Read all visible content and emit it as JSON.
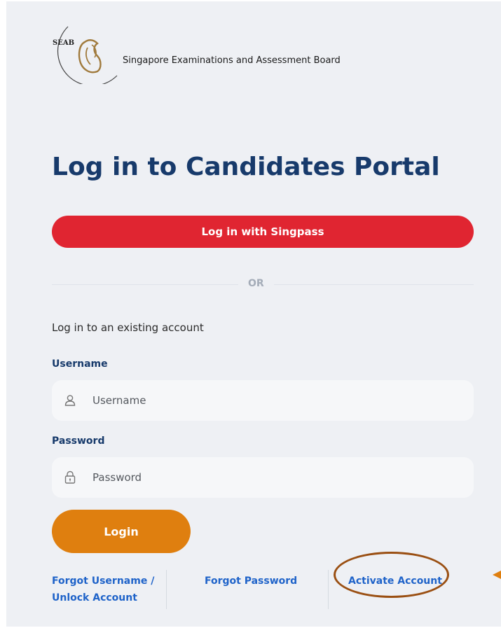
{
  "header": {
    "logo_text": "SEAB",
    "logo_arc_text": "Singapore Examinations & Assessment Board",
    "org_name": "Singapore Examinations and Assessment Board"
  },
  "title": "Log in to Candidates Portal",
  "singpass_button": "Log in with Singpass",
  "divider_text": "OR",
  "existing_account_text": "Log in to an existing account",
  "username": {
    "label": "Username",
    "placeholder": "Username",
    "icon": "user-icon"
  },
  "password": {
    "label": "Password",
    "placeholder": "Password",
    "icon": "lock-icon"
  },
  "login_button": "Login",
  "links": {
    "forgot_username_line1": "Forgot Username /",
    "forgot_username_line2": "Unlock Account",
    "forgot_password": "Forgot Password",
    "activate_account": "Activate Account"
  },
  "colors": {
    "title": "#173a6b",
    "singpass": "#e02531",
    "login": "#df7f0f",
    "link": "#1f63c9",
    "highlight": "#9a4f12"
  }
}
